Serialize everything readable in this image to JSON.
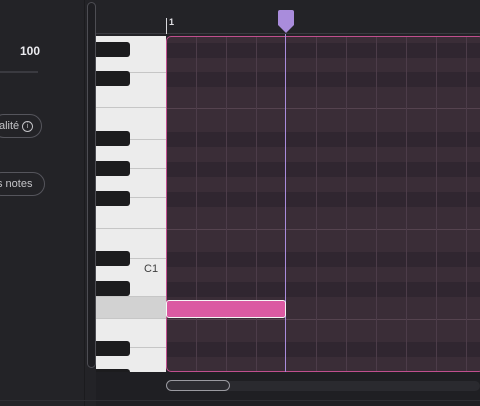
{
  "panel": {
    "value": "100",
    "quality_label": "alité",
    "notes_label": "s notes",
    "info_icon": "ⓘ"
  },
  "timeline": {
    "bar_number": "1"
  },
  "keyboard": {
    "c1_label": "C1"
  },
  "colors": {
    "note": "#db5aa2",
    "grid_border": "#c04f8e",
    "playhead": "#a98cdc"
  },
  "icons": {
    "playhead": "playhead-marker-icon",
    "info": "info-icon"
  }
}
